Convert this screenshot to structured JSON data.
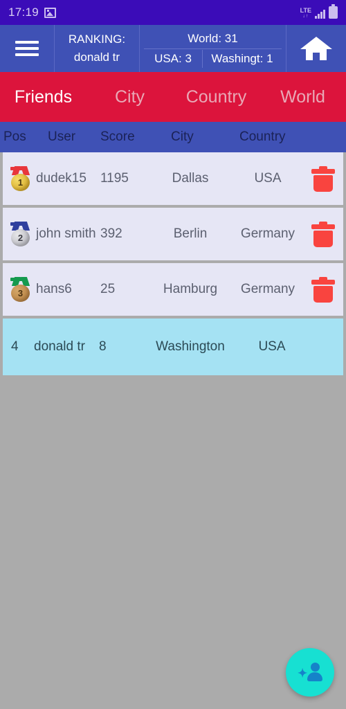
{
  "status_bar": {
    "time": "17:19",
    "image_icon": "image-icon",
    "network_label": "LTE",
    "network_arrows": "↓↑",
    "signal_icon": "signal-bars-icon",
    "battery_icon": "battery-icon"
  },
  "app_bar": {
    "menu_icon": "hamburger-menu-icon",
    "ranking_label": "RANKING:",
    "ranking_user": "donald tr",
    "world_stat": "World: 31",
    "usa_stat": "USA: 3",
    "city_stat": "Washingt: 1",
    "home_icon": "home-icon"
  },
  "tabs": [
    {
      "label": "Friends",
      "active": true
    },
    {
      "label": "City",
      "active": false
    },
    {
      "label": "Country",
      "active": false
    },
    {
      "label": "World",
      "active": false
    }
  ],
  "table": {
    "headers": {
      "pos": "Pos",
      "user": "User",
      "score": "Score",
      "city": "City",
      "country": "Country"
    },
    "rows": [
      {
        "pos": "1",
        "medal": "gold-medal",
        "user": "dudek15",
        "score": "1195",
        "city": "Dallas",
        "country": "USA",
        "deletable": true,
        "highlighted": false
      },
      {
        "pos": "2",
        "medal": "silver-medal",
        "user": "john smith",
        "score": "392",
        "city": "Berlin",
        "country": "Germany",
        "deletable": true,
        "highlighted": false
      },
      {
        "pos": "3",
        "medal": "bronze-medal",
        "user": "hans6",
        "score": "25",
        "city": "Hamburg",
        "country": "Germany",
        "deletable": true,
        "highlighted": false
      },
      {
        "pos": "4",
        "medal": "",
        "user": "donald tr",
        "score": "8",
        "city": "Washington",
        "country": "USA",
        "deletable": false,
        "highlighted": true
      }
    ]
  },
  "fab": {
    "icon": "add-person-icon"
  },
  "colors": {
    "status_bar": "#3B0CB8",
    "app_bar": "#3F51B5",
    "tab_bar": "#DC143C",
    "row": "#E6E6F5",
    "row_highlight": "#A5E2F3",
    "background": "#ABABAB",
    "delete": "#F9443F",
    "fab": "#17E0D2"
  }
}
